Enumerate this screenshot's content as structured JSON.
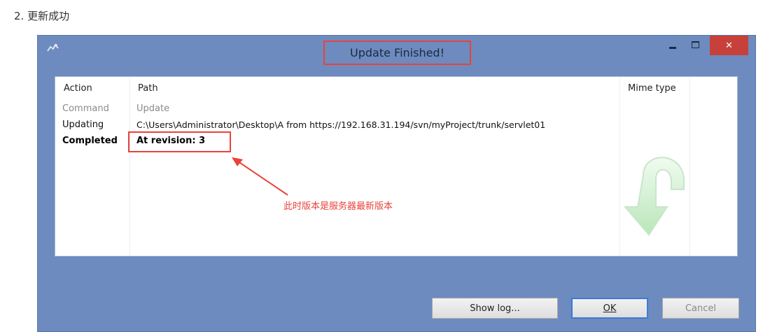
{
  "page": {
    "step_heading": "2. 更新成功"
  },
  "window": {
    "title": "Update Finished!",
    "icons": {
      "app": "tortoise-svn-icon",
      "minimize": "minimize-icon",
      "maximize": "maximize-icon",
      "close": "close-icon"
    },
    "close_label": "✕",
    "accent_close": "#c8403a",
    "background": "#6d8bbf"
  },
  "list": {
    "columns": [
      "Action",
      "Path",
      "Mime type"
    ],
    "rows": [
      {
        "action": "Command",
        "path": "Update",
        "style": "muted"
      },
      {
        "action": "Updating",
        "path": "C:\\Users\\Administrator\\Desktop\\A from https://192.168.31.194/svn/myProject/trunk/servlet01",
        "style": "normal"
      },
      {
        "action": "Completed",
        "path": "At revision: 3",
        "style": "strong"
      }
    ]
  },
  "annotation": {
    "text": "此时版本是服务器最新版本",
    "color": "#e8433b"
  },
  "graphic": {
    "icon": "update-arrow-icon"
  },
  "buttons": {
    "show_log": "Show log...",
    "ok": "OK",
    "cancel": "Cancel"
  }
}
